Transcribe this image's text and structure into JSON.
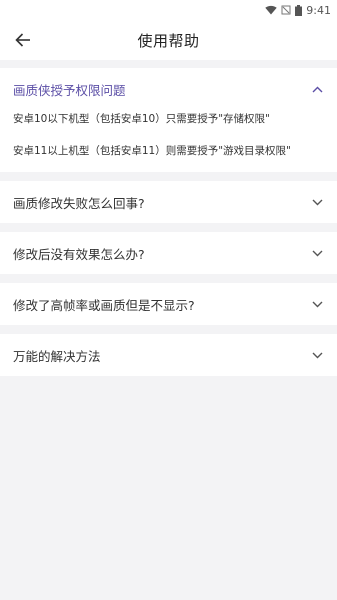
{
  "status_bar": {
    "time": "9:41",
    "icons": [
      "wifi-icon",
      "signal-off-icon",
      "battery-icon"
    ]
  },
  "header": {
    "title": "使用帮助",
    "back_icon": "arrow-left-icon"
  },
  "colors": {
    "accent": "#5b4ea6",
    "background": "#f3f3f5",
    "card": "#ffffff"
  },
  "faq": [
    {
      "question": "画质侠授予权限问题",
      "expanded": true,
      "answers": [
        "安卓10以下机型（包括安卓10）只需要授予\"存储权限\"",
        "安卓11以上机型（包括安卓11）则需要授予\"游戏目录权限\""
      ]
    },
    {
      "question": "画质修改失败怎么回事?",
      "expanded": false
    },
    {
      "question": "修改后没有效果怎么办?",
      "expanded": false
    },
    {
      "question": "修改了高帧率或画质但是不显示?",
      "expanded": false
    },
    {
      "question": "万能的解决方法",
      "expanded": false
    }
  ]
}
